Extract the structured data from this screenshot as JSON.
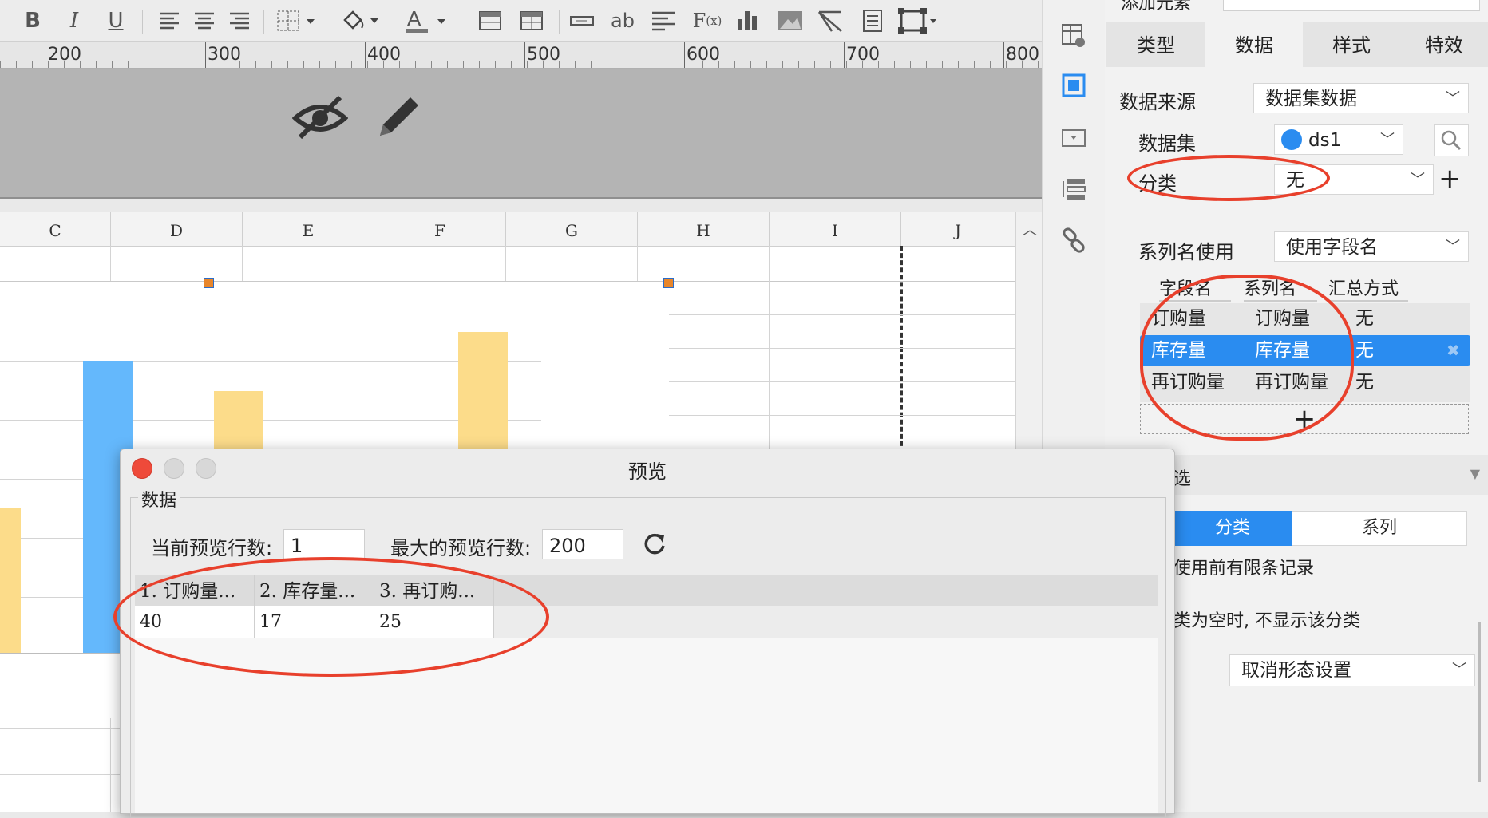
{
  "ruler": {
    "marks": [
      "200",
      "300",
      "400",
      "500",
      "600",
      "700",
      "800"
    ]
  },
  "sheet": {
    "columns": [
      "C",
      "D",
      "E",
      "F",
      "G",
      "H",
      "I",
      "J"
    ]
  },
  "side_panel": {
    "top_partial_label": "添加元素",
    "tabs": [
      "类型",
      "数据",
      "样式",
      "特效"
    ],
    "data_source_label": "数据来源",
    "data_source_value": "数据集数据",
    "dataset_label": "数据集",
    "dataset_value": "ds1",
    "category_label": "分类",
    "category_value": "无",
    "series_name_label": "系列名使用",
    "series_name_value": "使用字段名",
    "grid_headers": [
      "字段名",
      "系列名",
      "汇总方式"
    ],
    "grid_rows": [
      {
        "field": "订购量",
        "series": "订购量",
        "agg": "无"
      },
      {
        "field": "库存量",
        "series": "库存量",
        "agg": "无"
      },
      {
        "field": "再订购量",
        "series": "再订购量",
        "agg": "无"
      }
    ],
    "add_symbol": "+",
    "filter_section": "选",
    "filter_tabs": [
      "分类",
      "系列"
    ],
    "option1": "使用前有限条记录",
    "option2": "类为空时, 不显示该分类",
    "morph_value": "取消形态设置"
  },
  "dialog": {
    "title": "预览",
    "group_label": "数据",
    "current_rows_label": "当前预览行数:",
    "current_rows_value": "1",
    "max_rows_label": "最大的预览行数:",
    "max_rows_value": "200",
    "table_headers": [
      "1. 订购量...",
      "2. 库存量...",
      "3. 再订购..."
    ],
    "table_rows": [
      [
        "40",
        "17",
        "25"
      ]
    ]
  },
  "colors": {
    "accent": "#2a8cf0",
    "selected_row": "#2a8cf0",
    "annotation": "#e8402c",
    "bar_blue": "#64b8fc",
    "bar_yellow": "#fcdc8a"
  }
}
